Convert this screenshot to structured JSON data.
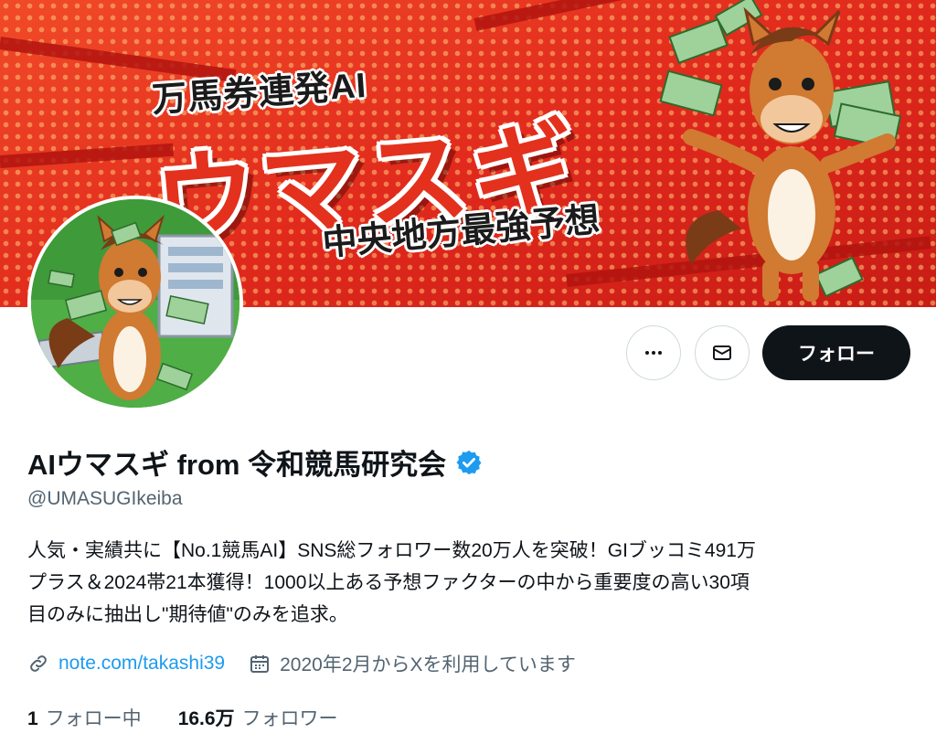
{
  "banner": {
    "headline_top": "万馬券連発AI",
    "headline_main": "ウマスギ",
    "headline_sub": "中央地方最強予想"
  },
  "profile": {
    "display_name": "AIウマスギ from 令和競馬研究会",
    "handle": "@UMASUGIkeiba",
    "bio_lines": [
      "人気・実績共に【No.1競馬AI】SNS総フォロワー数20万人を突破！GIブッコミ491万",
      "プラス＆2024帯21本獲得！1000以上ある予想ファクターの中から重要度の高い30項",
      "目のみに抽出し\"期待値\"のみを追求。"
    ],
    "link": "note.com/takashi39",
    "joined": "2020年2月からXを利用しています"
  },
  "actions": {
    "more_icon": "more-icon",
    "mail_icon": "mail-icon",
    "follow_label": "フォロー"
  },
  "stats": {
    "following_count": "1",
    "following_label": "フォロー中",
    "followers_count": "16.6万",
    "followers_label": "フォロワー"
  },
  "colors": {
    "banner_red": "#e5321f",
    "verified_blue": "#1d9bf0",
    "link_blue": "#1d9bf0",
    "text_secondary": "#536471",
    "follow_button": "#0f1419"
  }
}
